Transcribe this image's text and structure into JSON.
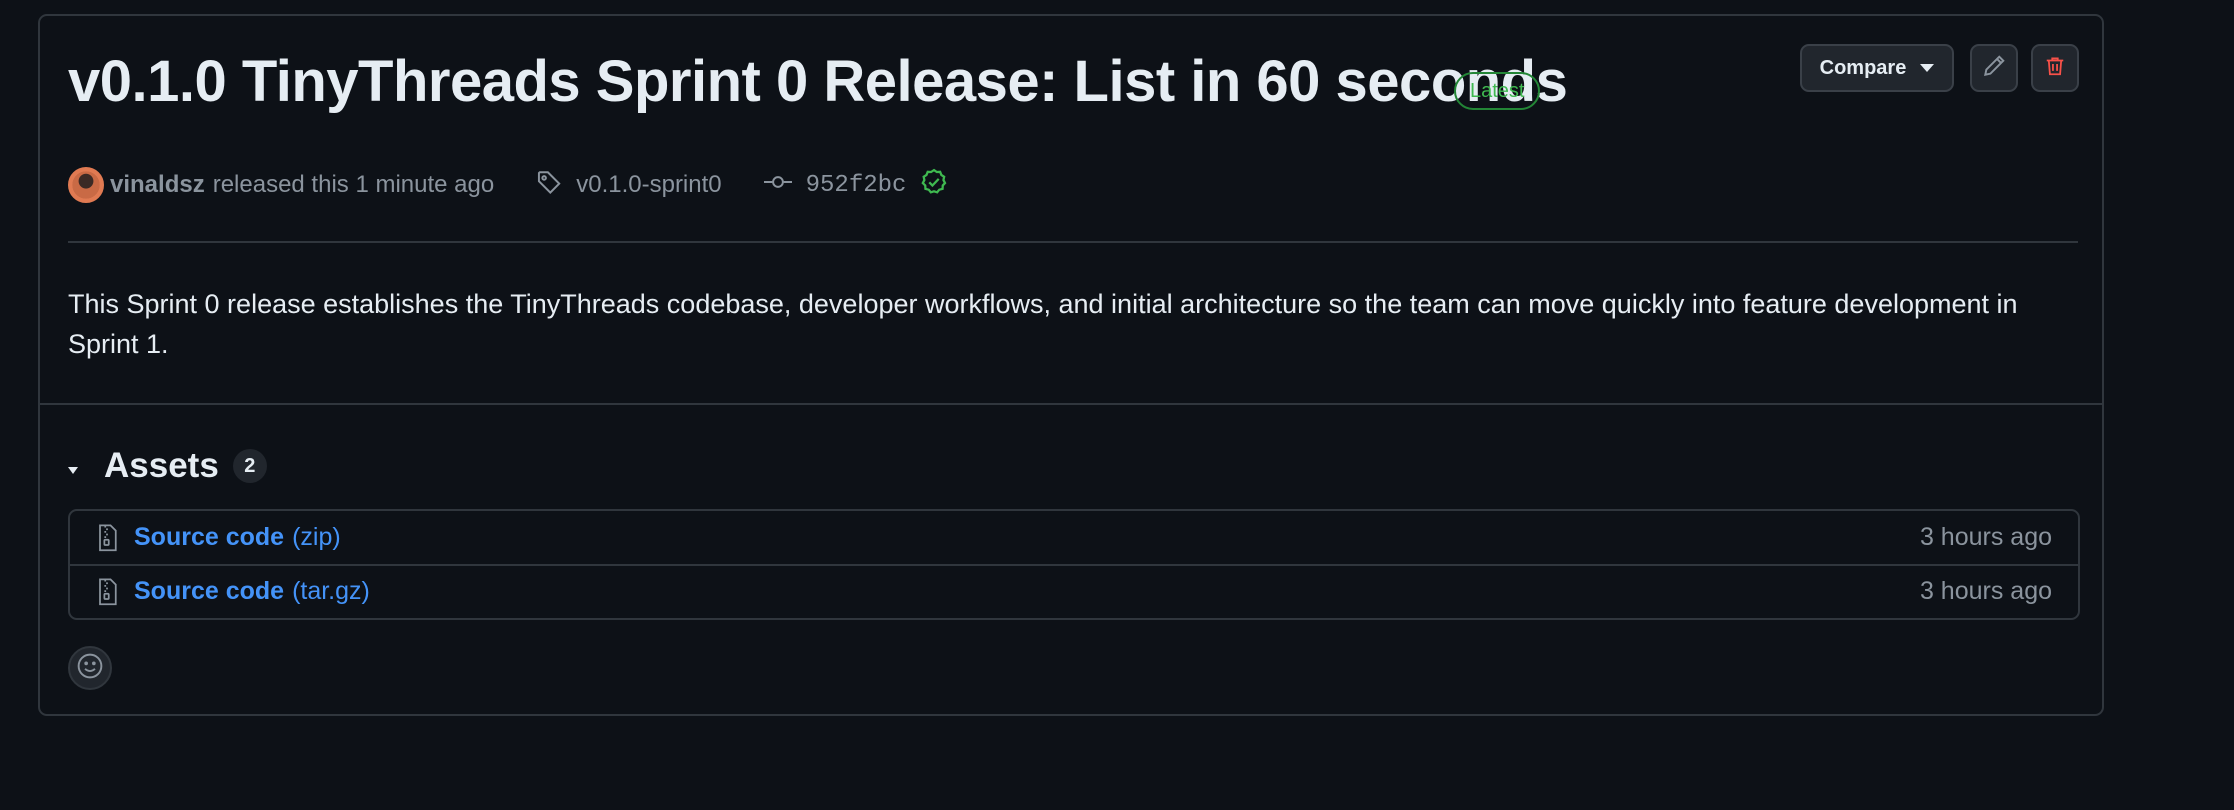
{
  "release": {
    "title": "v0.1.0 TinyThreads Sprint 0 Release: List in 60 seconds",
    "latest_badge": "Latest",
    "author": "vinaldsz",
    "released_text": "released this 1 minute ago",
    "tag": "v0.1.0-sprint0",
    "commit": "952f2bc",
    "description": "This Sprint 0 release establishes the TinyThreads codebase, developer workflows, and initial architecture so the team can move quickly into feature development in Sprint 1."
  },
  "actions": {
    "compare_label": "Compare"
  },
  "assets": {
    "title": "Assets",
    "count": "2",
    "items": [
      {
        "name": "Source code",
        "ext": "(zip)",
        "time": "3 hours ago"
      },
      {
        "name": "Source code",
        "ext": "(tar.gz)",
        "time": "3 hours ago"
      }
    ]
  },
  "icons": {
    "tag": "tag-icon",
    "commit": "git-commit-icon",
    "verified": "check-circle-icon",
    "edit": "pencil-icon",
    "delete": "trash-icon",
    "zip": "file-zip-icon",
    "reaction": "smiley-icon"
  },
  "colors": {
    "background": "#0d1117",
    "border": "#30363d",
    "link": "#4493f8",
    "success": "#3fb950",
    "danger": "#f85149",
    "muted": "#8b949e"
  }
}
